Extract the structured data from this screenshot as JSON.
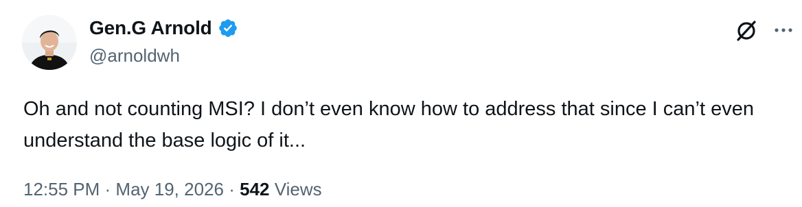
{
  "author": {
    "display_name": "Gen.G Arnold",
    "handle": "@arnoldwh",
    "verified": true,
    "verified_color": "#1d9bf0"
  },
  "tweet": {
    "text": "Oh and not counting MSI? I don’t even know how to address that since I can’t even understand the base logic of it..."
  },
  "meta": {
    "time": "12:55 PM",
    "separator": "·",
    "date": "May 19, 2026",
    "views_count": "542",
    "views_label": "Views"
  },
  "icons": {
    "verified": "verified-badge-icon",
    "grok": "grok-icon",
    "more": "more-icon"
  },
  "colors": {
    "text_primary": "#0f1419",
    "text_secondary": "#536471",
    "accent": "#1d9bf0"
  }
}
